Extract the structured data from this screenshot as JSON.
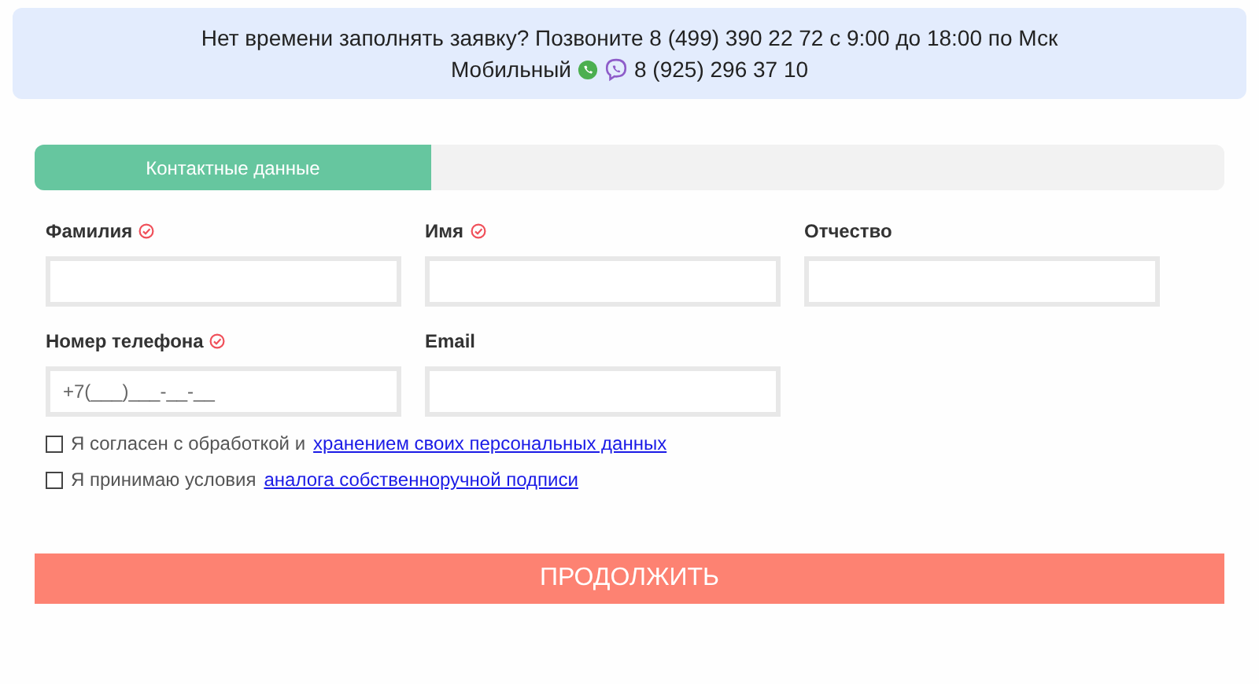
{
  "notice": {
    "line_1": "Нет времени заполнять заявку? Позвоните 8 (499) 390 22 72 с 9:00 до 18:00 по Мск",
    "mobile_label": "Мобильный",
    "mobile_phone": "8 (925) 296 37 10"
  },
  "tabs": [
    {
      "label": "Контактные данные",
      "selected": true
    },
    {
      "selected": false
    },
    {
      "selected": false
    }
  ],
  "fields": [
    {
      "label": "Фамилия",
      "required": true
    },
    {
      "label": "Имя",
      "required": true
    },
    {
      "label": "Отчество",
      "required": false
    },
    {
      "label": "Номер телефона",
      "required": true,
      "placeholder": "+7(___)___-__-__"
    },
    {
      "label": "Email",
      "required": false
    }
  ],
  "agreements": [
    {
      "text": "Я согласен с обработкой и",
      "link": "хранением своих персональных данных",
      "checked": false
    },
    {
      "text": "Я принимаю условия",
      "link": "аналога собственноручной подписи",
      "checked": false
    }
  ],
  "submit": "ПРОДОЛЖИТЬ"
}
